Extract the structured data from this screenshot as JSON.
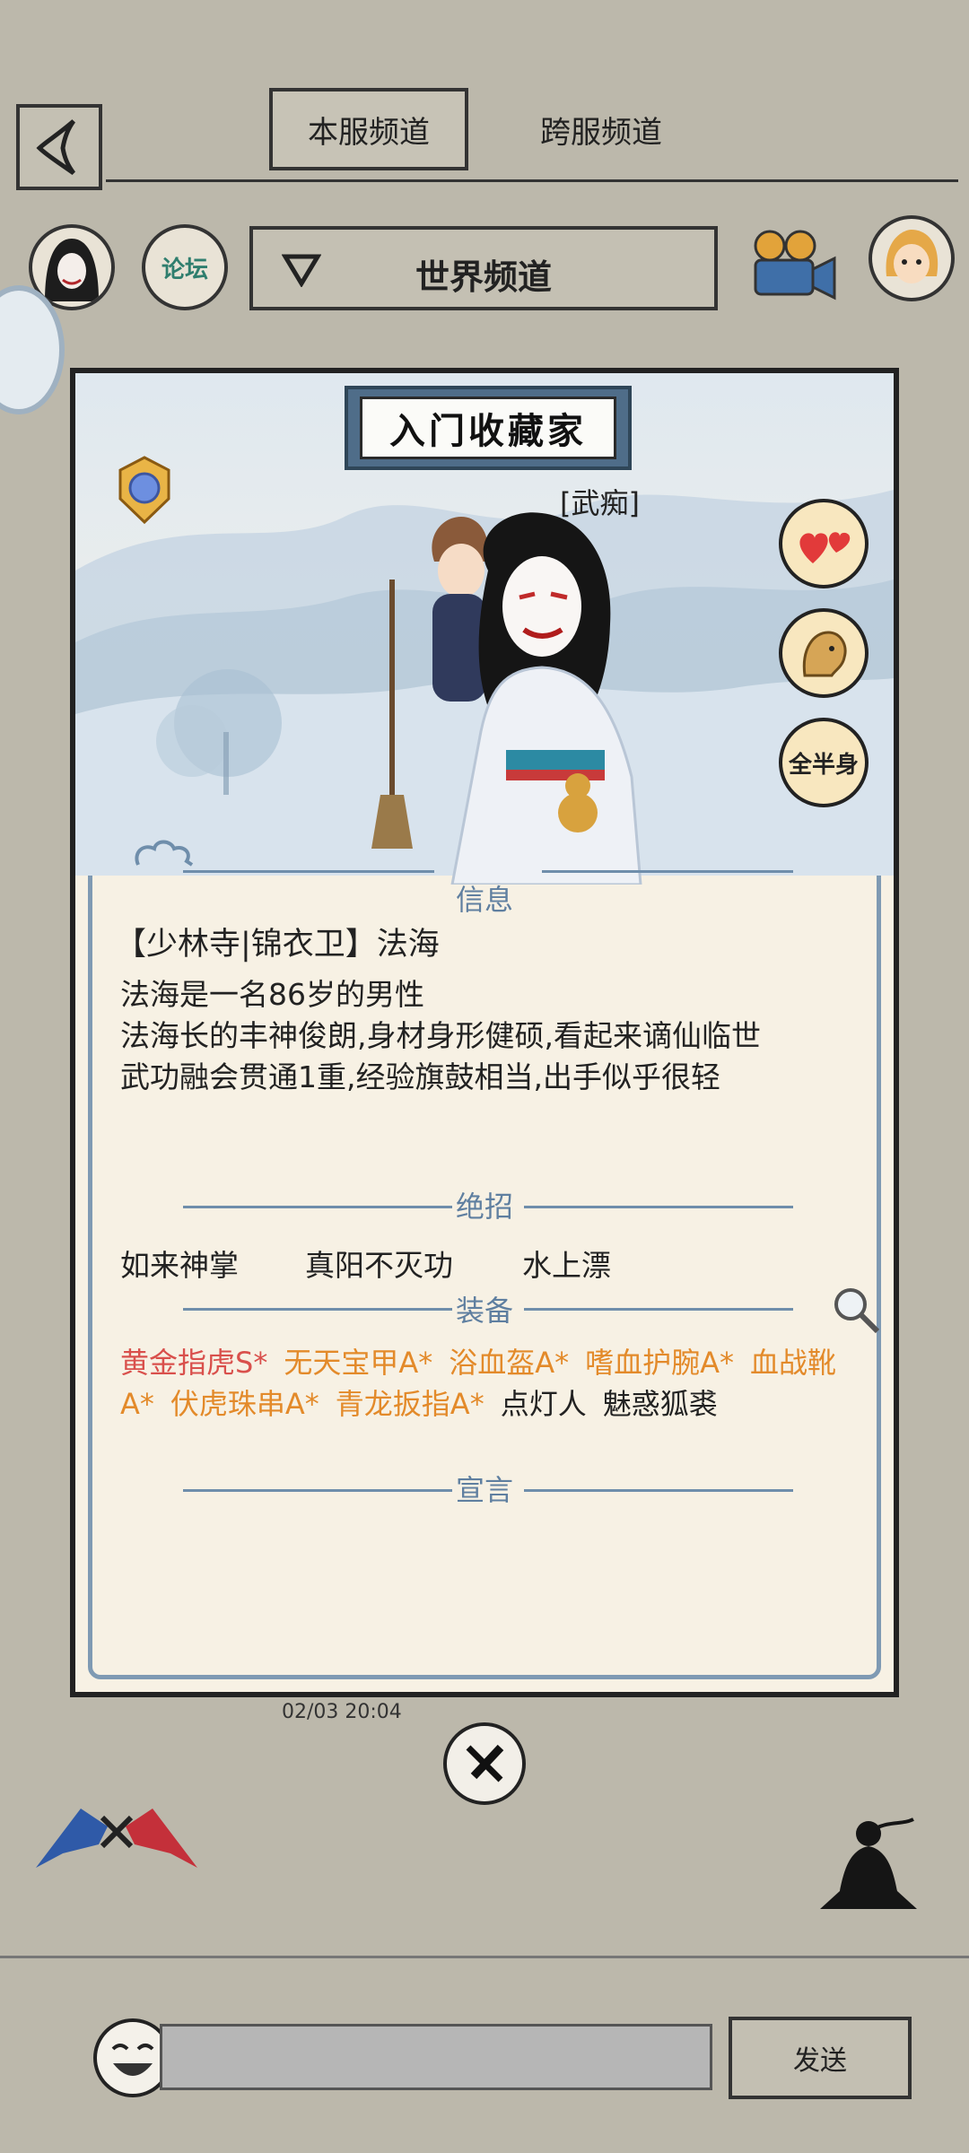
{
  "header": {
    "tabs": [
      {
        "label": "本服频道",
        "active": true
      },
      {
        "label": "跨服频道",
        "active": false
      }
    ]
  },
  "toolbar": {
    "forum_label": "论坛",
    "channel_label": "世界频道"
  },
  "profile": {
    "title_plate": "入门收藏家",
    "title_tag": "[武痴]",
    "body_toggle": "全半身",
    "sections": {
      "info": "信息",
      "skills": "绝招",
      "equipment": "装备",
      "declaration": "宣言"
    },
    "info_lines": [
      "【少林寺|锦衣卫】法海",
      "法海是一名86岁的男性",
      "法海长的丰神俊朗,身材身形健硕,看起来谪仙临世",
      "武功融会贯通1重,经验旗鼓相当,出手似乎很轻"
    ],
    "skills": [
      "如来神掌",
      "真阳不灭功",
      "水上漂"
    ],
    "equipment_line1": [
      {
        "text": "黄金指虎S*",
        "color": "red"
      },
      {
        "text": "无天宝甲A*",
        "color": "orange"
      },
      {
        "text": "浴血盔A*",
        "color": "orange"
      },
      {
        "text": "嗜血护腕A*",
        "color": "orange"
      },
      {
        "text": "血战靴",
        "color": "orange"
      }
    ],
    "equipment_line2": [
      {
        "text": "A*",
        "color": "orange"
      },
      {
        "text": "伏虎珠串A*",
        "color": "orange"
      },
      {
        "text": "青龙扳指A*",
        "color": "orange"
      },
      {
        "text": "点灯人",
        "color": "dark"
      },
      {
        "text": "魅惑狐裘",
        "color": "dark"
      }
    ],
    "declaration_text": ""
  },
  "chat": {
    "timestamp": "02/03 20:04"
  },
  "footer": {
    "input_placeholder": "",
    "send_label": "发送"
  },
  "colors": {
    "background": "#bcb8ab",
    "card_bg": "#f7f1e4",
    "section_blue": "#5f7fa0",
    "equip_red": "#d9504c",
    "equip_orange": "#e38a2a"
  }
}
